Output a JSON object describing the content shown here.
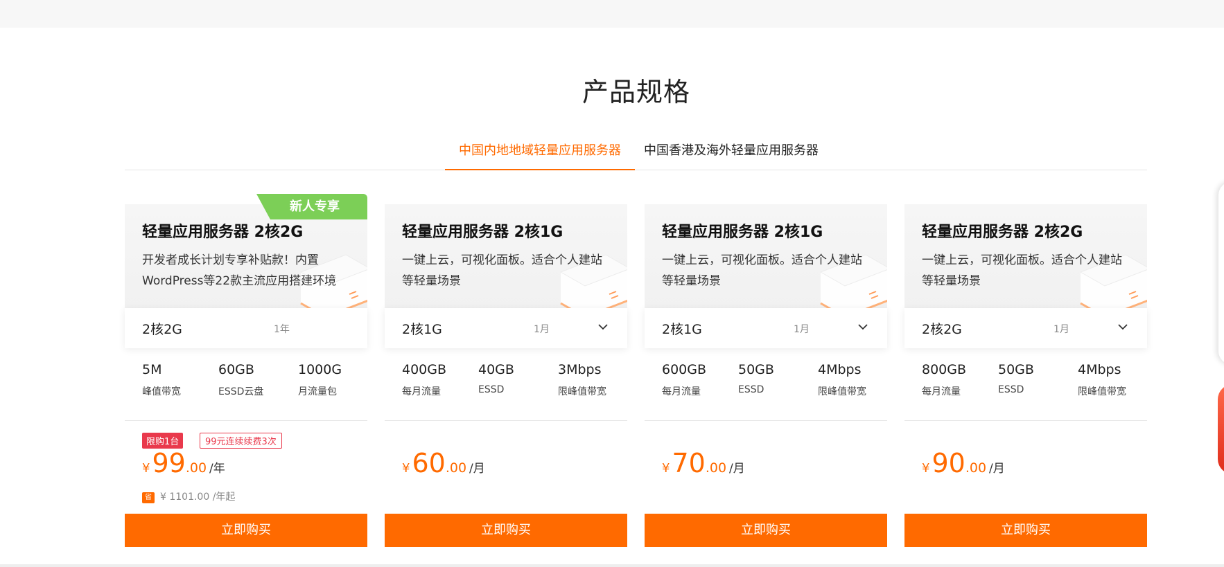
{
  "section": {
    "title": "产品规格"
  },
  "tabs": [
    {
      "label": "中国内地地域轻量应用服务器",
      "active": true
    },
    {
      "label": "中国香港及海外轻量应用服务器",
      "active": false
    }
  ],
  "colors": {
    "accent": "#ff6a00",
    "badge_green": "#7ccf57",
    "tag_red": "#e9394c"
  },
  "cards": [
    {
      "badge": "新人专享",
      "title": "轻量应用服务器 2核2G",
      "desc": "开发者成长计划专享补贴款！内置WordPress等22款主流应用搭建环境",
      "config": "2核2G",
      "duration": "1年",
      "has_dropdown": false,
      "specs": [
        {
          "value": "5M",
          "label": "峰值带宽"
        },
        {
          "value": "60GB",
          "label": "ESSD云盘"
        },
        {
          "value": "1000G",
          "label": "月流量包"
        }
      ],
      "tag_limit": "限购1台",
      "tag_renew": "99元连续续费3次",
      "price": {
        "currency": "¥",
        "integer": "99",
        "decimal": ".00",
        "unit": "/年"
      },
      "save_icon": "省",
      "save_text": "¥ 1101.00 /年起",
      "buy": "立即购买"
    },
    {
      "title": "轻量应用服务器 2核1G",
      "desc": "一键上云，可视化面板。适合个人建站等轻量场景",
      "config": "2核1G",
      "duration": "1月",
      "has_dropdown": true,
      "specs": [
        {
          "value": "400GB",
          "label": "每月流量"
        },
        {
          "value": "40GB",
          "label": "ESSD"
        },
        {
          "value": "3Mbps",
          "label": "限峰值带宽"
        }
      ],
      "price": {
        "currency": "¥",
        "integer": "60",
        "decimal": ".00",
        "unit": "/月"
      },
      "buy": "立即购买"
    },
    {
      "title": "轻量应用服务器 2核1G",
      "desc": "一键上云，可视化面板。适合个人建站等轻量场景",
      "config": "2核1G",
      "duration": "1月",
      "has_dropdown": true,
      "specs": [
        {
          "value": "600GB",
          "label": "每月流量"
        },
        {
          "value": "50GB",
          "label": "ESSD"
        },
        {
          "value": "4Mbps",
          "label": "限峰值带宽"
        }
      ],
      "price": {
        "currency": "¥",
        "integer": "70",
        "decimal": ".00",
        "unit": "/月"
      },
      "buy": "立即购买"
    },
    {
      "title": "轻量应用服务器 2核2G",
      "desc": "一键上云，可视化面板。适合个人建站等轻量场景",
      "config": "2核2G",
      "duration": "1月",
      "has_dropdown": true,
      "specs": [
        {
          "value": "800GB",
          "label": "每月流量"
        },
        {
          "value": "50GB",
          "label": "ESSD"
        },
        {
          "value": "4Mbps",
          "label": "限峰值带宽"
        }
      ],
      "price": {
        "currency": "¥",
        "integer": "90",
        "decimal": ".00",
        "unit": "/月"
      },
      "buy": "立即购买"
    }
  ]
}
